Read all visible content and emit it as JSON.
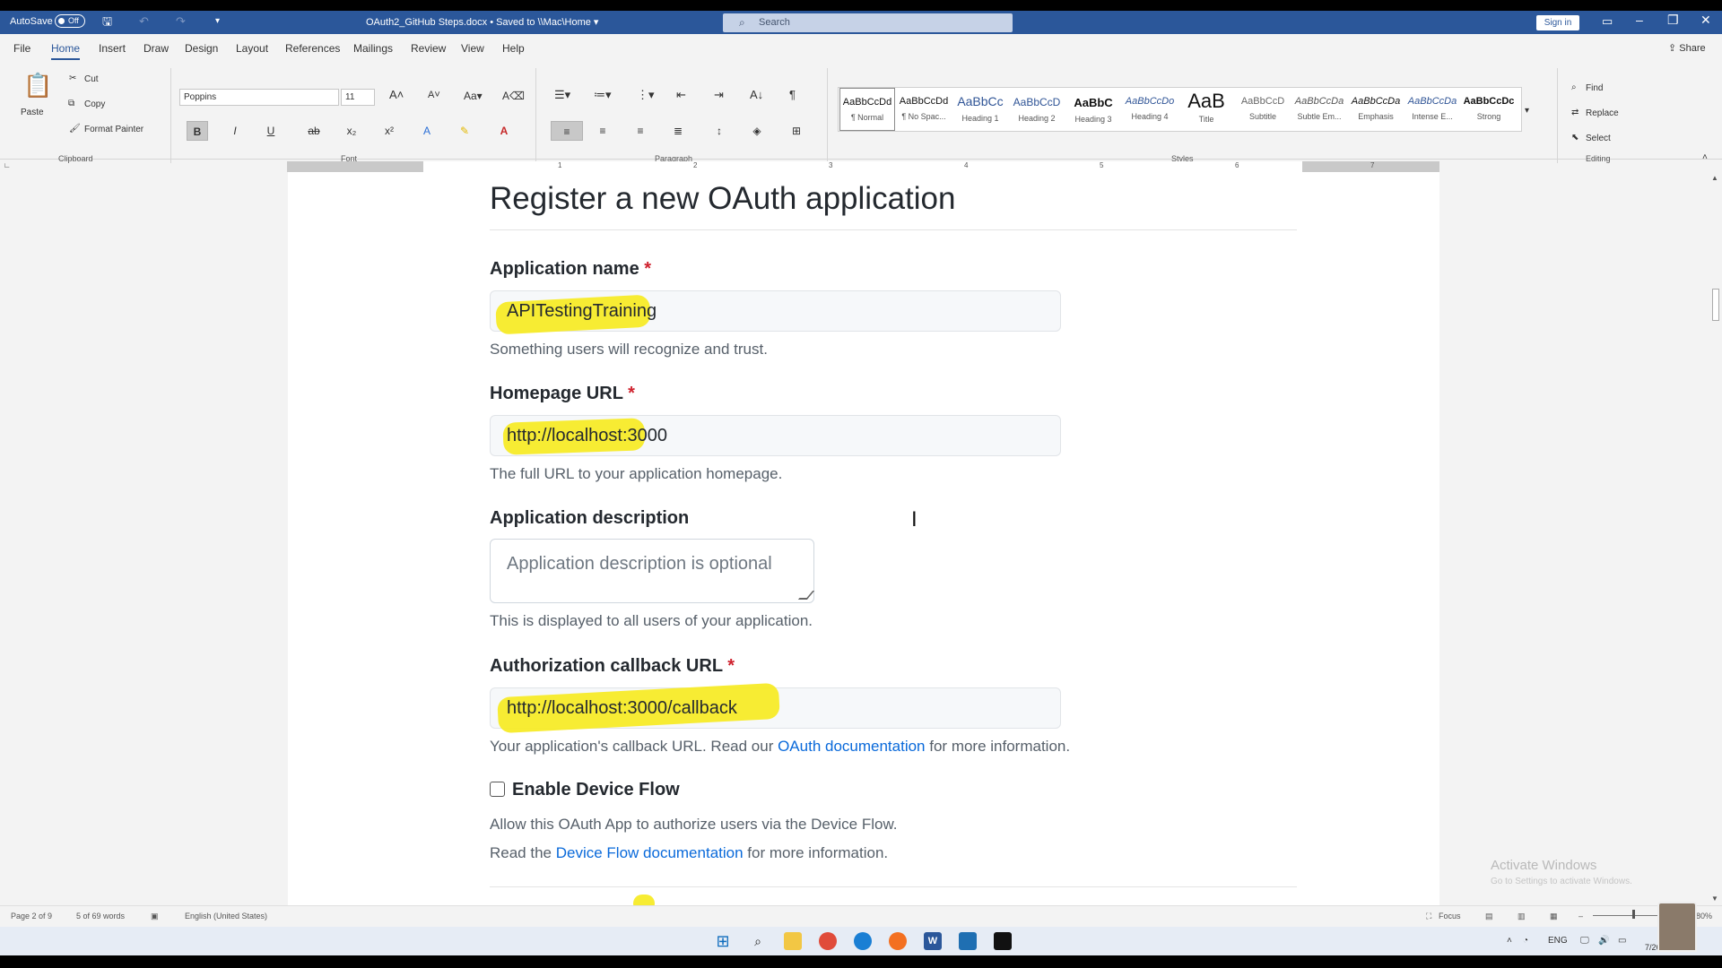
{
  "titlebar": {
    "autosave_label": "AutoSave",
    "autosave_state": "Off",
    "doc_title": "OAuth2_GitHub Steps.docx  •  Saved to \\\\Mac\\Home ▾",
    "search_placeholder": "Search",
    "signin_label": "Sign in",
    "minimize": "–",
    "restore": "❐",
    "close": "✕"
  },
  "menu": {
    "tabs": [
      "File",
      "Home",
      "Insert",
      "Draw",
      "Design",
      "Layout",
      "References",
      "Mailings",
      "Review",
      "View",
      "Help"
    ],
    "active": "Home",
    "share": "Share"
  },
  "ribbon": {
    "clipboard": {
      "paste": "Paste",
      "cut": "Cut",
      "copy": "Copy",
      "format_painter": "Format Painter",
      "label": "Clipboard"
    },
    "font": {
      "name": "Poppins",
      "size": "11",
      "label": "Font"
    },
    "paragraph": {
      "label": "Paragraph"
    },
    "styles": {
      "label": "Styles",
      "items": [
        {
          "sample": "AaBbCcDd",
          "name": "¶ Normal"
        },
        {
          "sample": "AaBbCcDd",
          "name": "¶ No Spac..."
        },
        {
          "sample": "AaBbCc",
          "name": "Heading 1"
        },
        {
          "sample": "AaBbCcD",
          "name": "Heading 2"
        },
        {
          "sample": "AaBbC",
          "name": "Heading 3"
        },
        {
          "sample": "AaBbCcDo",
          "name": "Heading 4"
        },
        {
          "sample": "AaB",
          "name": "Title"
        },
        {
          "sample": "AaBbCcD",
          "name": "Subtitle"
        },
        {
          "sample": "AaBbCcDa",
          "name": "Subtle Em..."
        },
        {
          "sample": "AaBbCcDa",
          "name": "Emphasis"
        },
        {
          "sample": "AaBbCcDa",
          "name": "Intense E..."
        },
        {
          "sample": "AaBbCcDc",
          "name": "Strong"
        }
      ]
    },
    "editing": {
      "find": "Find",
      "replace": "Replace",
      "select": "Select",
      "label": "Editing"
    }
  },
  "ruler_numbers": [
    "1",
    "2",
    "3",
    "4",
    "5",
    "6",
    "7"
  ],
  "document": {
    "heading": "Register a new OAuth application",
    "app_name_label": "Application name",
    "app_name_value": "APITestingTraining",
    "app_name_hint": "Something users will recognize and trust.",
    "homepage_label": "Homepage URL",
    "homepage_value": "http://localhost:3000",
    "homepage_hint": "The full URL to your application homepage.",
    "desc_label": "Application description",
    "desc_placeholder": "Application description is optional",
    "desc_hint": "This is displayed to all users of your application.",
    "callback_label": "Authorization callback URL",
    "callback_value": "http://localhost:3000/callback",
    "callback_hint_pre": "Your application's callback URL. Read our ",
    "callback_hint_link": "OAuth documentation",
    "callback_hint_post": " for more information.",
    "device_flow_label": "Enable Device Flow",
    "device_flow_checked": false,
    "device_flow_hint1": "Allow this OAuth App to authorize users via the Device Flow.",
    "device_flow_hint2_pre": "Read the ",
    "device_flow_hint2_link": "Device Flow documentation",
    "device_flow_hint2_post": " for more information.",
    "required_mark": "*"
  },
  "watermark": {
    "line1": "Activate Windows",
    "line2": "Go to Settings to activate Windows."
  },
  "statusbar": {
    "page": "Page 2 of 9",
    "words": "5 of 69 words",
    "language": "English (United States)",
    "focus": "Focus",
    "zoom": "180%"
  },
  "taskbar": {
    "lang": "ENG",
    "date": "7/26/2022"
  },
  "colors": {
    "word_blue": "#2b579a",
    "highlight": "#f6ea22",
    "link": "#0969da",
    "required": "#cf222e"
  }
}
